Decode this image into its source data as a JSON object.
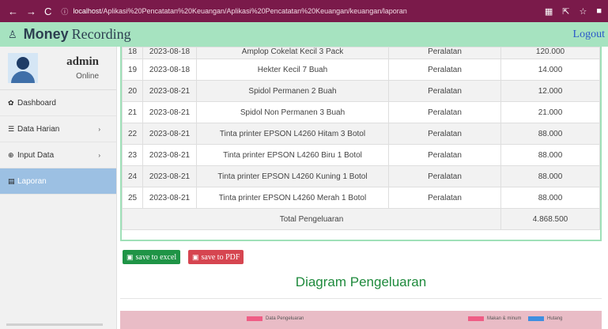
{
  "browser": {
    "url_host": "localhost",
    "url_path": "/Aplikasi%20Pencatatan%20Keuangan/Aplikasi%20Pencatatan%20Keuangan/keuangan/laporan"
  },
  "app": {
    "brand_bold": "Money",
    "brand_rest": "Recording",
    "logout_label": "Logout"
  },
  "user": {
    "name": "admin",
    "status": "Online"
  },
  "sidebar": {
    "items": [
      {
        "label": "Dashboard"
      },
      {
        "label": "Data Harian"
      },
      {
        "label": "Input Data"
      },
      {
        "label": "Laporan"
      }
    ]
  },
  "table": {
    "rows": [
      {
        "no": "18",
        "date": "2023-08-18",
        "item": "Amplop Cokelat Kecil 3 Pack",
        "category": "Peralatan",
        "amount": "120.000"
      },
      {
        "no": "19",
        "date": "2023-08-18",
        "item": "Hekter Kecil 7 Buah",
        "category": "Peralatan",
        "amount": "14.000"
      },
      {
        "no": "20",
        "date": "2023-08-21",
        "item": "Spidol Permanen 2 Buah",
        "category": "Peralatan",
        "amount": "12.000"
      },
      {
        "no": "21",
        "date": "2023-08-21",
        "item": "Spidol Non Permanen 3 Buah",
        "category": "Peralatan",
        "amount": "21.000"
      },
      {
        "no": "22",
        "date": "2023-08-21",
        "item": "Tinta printer EPSON L4260 Hitam 3 Botol",
        "category": "Peralatan",
        "amount": "88.000"
      },
      {
        "no": "23",
        "date": "2023-08-21",
        "item": "Tinta printer EPSON L4260 Biru 1 Botol",
        "category": "Peralatan",
        "amount": "88.000"
      },
      {
        "no": "24",
        "date": "2023-08-21",
        "item": "Tinta printer EPSON L4260 Kuning 1 Botol",
        "category": "Peralatan",
        "amount": "88.000"
      },
      {
        "no": "25",
        "date": "2023-08-21",
        "item": "Tinta printer EPSON L4260 Merah 1 Botol",
        "category": "Peralatan",
        "amount": "88.000"
      }
    ],
    "total_label": "Total Pengeluaran",
    "total_value": "4.868.500"
  },
  "actions": {
    "excel_label": "save to excel",
    "pdf_label": "save to PDF"
  },
  "chart": {
    "title": "Diagram Pengeluaran",
    "legend_left": "Data Pengeluaran",
    "legend_right_1": "Makan & minum",
    "legend_right_2": "Hutang"
  },
  "colors": {
    "browser_bar": "#7a1a4a",
    "app_header": "#a6e3c0",
    "active_menu": "#9cc0e3",
    "excel_button": "#1f9446",
    "pdf_button": "#d64550",
    "chart_title": "#1e8a3c",
    "chart_background": "#e9bcc6",
    "legend_pink": "#ef5d85",
    "legend_blue": "#3f8fe0"
  },
  "icons": {
    "dashboard": "palette-icon",
    "data_harian": "database-icon",
    "input_data": "plus-circle-icon",
    "laporan": "book-icon",
    "file": "file-icon"
  }
}
